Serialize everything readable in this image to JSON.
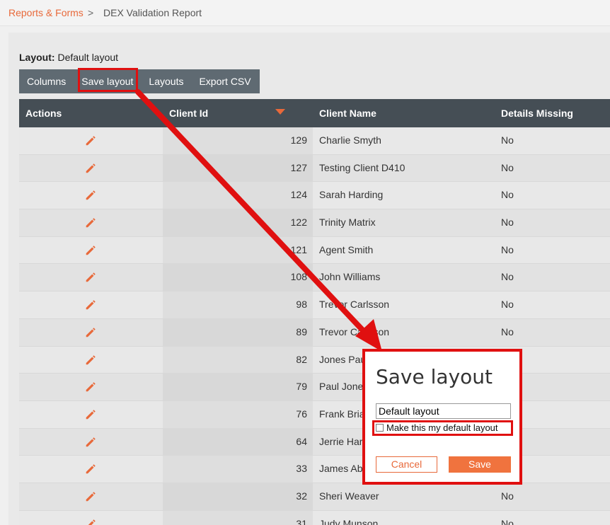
{
  "breadcrumb": {
    "parent": "Reports & Forms",
    "separator": ">",
    "current": "DEX Validation Report"
  },
  "layout": {
    "label": "Layout:",
    "value": "Default layout"
  },
  "toolbar": {
    "columns": "Columns",
    "save_layout": "Save layout",
    "layouts": "Layouts",
    "export_csv": "Export CSV"
  },
  "grid": {
    "headers": {
      "actions": "Actions",
      "client_id": "Client Id",
      "client_name": "Client Name",
      "details_missing": "Details Missing"
    },
    "sort_color": "#e8693a",
    "rows": [
      {
        "id": "129",
        "name": "Charlie Smyth",
        "missing": "No"
      },
      {
        "id": "127",
        "name": "Testing Client D410",
        "missing": "No"
      },
      {
        "id": "124",
        "name": "Sarah Harding",
        "missing": "No"
      },
      {
        "id": "122",
        "name": "Trinity Matrix",
        "missing": "No"
      },
      {
        "id": "121",
        "name": "Agent Smith",
        "missing": "No"
      },
      {
        "id": "108",
        "name": "John Williams",
        "missing": "No"
      },
      {
        "id": "98",
        "name": "Trevor Carlsson",
        "missing": "No"
      },
      {
        "id": "89",
        "name": "Trevor Carlsson",
        "missing": "No"
      },
      {
        "id": "82",
        "name": "Jones Pau",
        "missing": ""
      },
      {
        "id": "79",
        "name": "Paul Jone",
        "missing": ""
      },
      {
        "id": "76",
        "name": "Frank Bria",
        "missing": ""
      },
      {
        "id": "64",
        "name": "Jerrie Har",
        "missing": ""
      },
      {
        "id": "33",
        "name": "James Ab",
        "missing": ""
      },
      {
        "id": "32",
        "name": "Sheri Weaver",
        "missing": "No"
      },
      {
        "id": "31",
        "name": "Judy Munson",
        "missing": "No"
      }
    ]
  },
  "dialog": {
    "title": "Save layout",
    "name_value": "Default layout",
    "default_checkbox_label": "Make this my default layout",
    "cancel": "Cancel",
    "save": "Save"
  },
  "colors": {
    "accent": "#e8693a",
    "annotation": "#e01010",
    "header_bg": "#454e55",
    "toolbar_bg": "#5f6a72"
  }
}
